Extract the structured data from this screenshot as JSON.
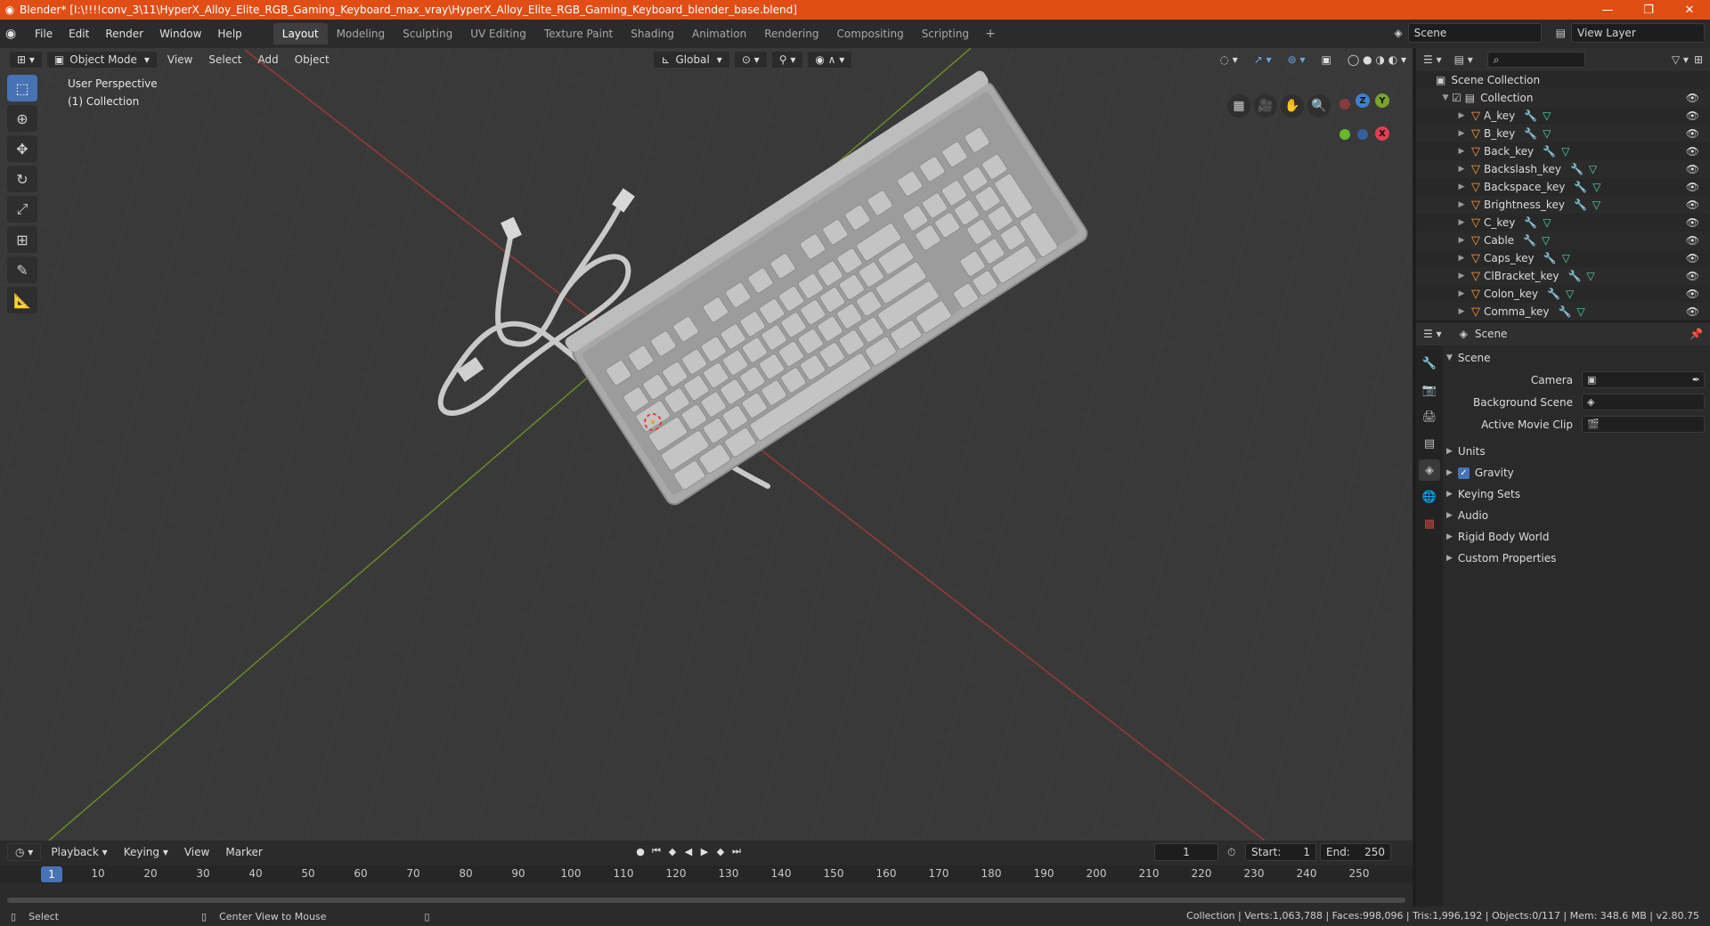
{
  "window": {
    "title": "Blender* [I:\\!!!!conv_3\\11\\HyperX_Alloy_Elite_RGB_Gaming_Keyboard_max_vray\\HyperX_Alloy_Elite_RGB_Gaming_Keyboard_blender_base.blend]",
    "minimize": "—",
    "maximize": "❐",
    "close": "✕"
  },
  "menu": [
    "File",
    "Edit",
    "Render",
    "Window",
    "Help"
  ],
  "workspaces": [
    "Layout",
    "Modeling",
    "Sculpting",
    "UV Editing",
    "Texture Paint",
    "Shading",
    "Animation",
    "Rendering",
    "Compositing",
    "Scripting"
  ],
  "active_workspace": "Layout",
  "scene_field": "Scene",
  "view_layer_field": "View Layer",
  "viewport_header": {
    "mode": "Object Mode",
    "menus": [
      "View",
      "Select",
      "Add",
      "Object"
    ],
    "orientation": "Global"
  },
  "viewport_info": {
    "line1": "User Perspective",
    "line2": "(1) Collection"
  },
  "gizmo": {
    "z": "Z",
    "y": "Y",
    "x": "X"
  },
  "outliner": {
    "root": "Scene Collection",
    "collection": "Collection",
    "items": [
      "A_key",
      "B_key",
      "Back_key",
      "Backslash_key",
      "Backspace_key",
      "Brightness_key",
      "C_key",
      "Cable",
      "Caps_key",
      "ClBracket_key",
      "Colon_key",
      "Comma_key"
    ]
  },
  "properties": {
    "header": "Scene",
    "section": "Scene",
    "fields": [
      {
        "label": "Camera",
        "value": ""
      },
      {
        "label": "Background Scene",
        "value": ""
      },
      {
        "label": "Active Movie Clip",
        "value": ""
      }
    ],
    "panels": [
      "Units",
      "Gravity",
      "Keying Sets",
      "Audio",
      "Rigid Body World",
      "Custom Properties"
    ]
  },
  "timeline": {
    "menus": [
      "Playback",
      "Keying",
      "View",
      "Marker"
    ],
    "current_frame": "1",
    "start_label": "Start:",
    "start": "1",
    "end_label": "End:",
    "end": "250",
    "ruler": [
      "10",
      "20",
      "30",
      "40",
      "50",
      "60",
      "70",
      "80",
      "90",
      "100",
      "110",
      "120",
      "130",
      "140",
      "150",
      "160",
      "170",
      "180",
      "190",
      "200",
      "210",
      "220",
      "230",
      "240",
      "250"
    ]
  },
  "statusbar": {
    "left1": "Select",
    "left2": "Center View to Mouse",
    "right": "Collection | Verts:1,063,788 | Faces:998,096 | Tris:1,996,192 | Objects:0/117 | Mem: 348.6 MB | v2.80.75"
  }
}
